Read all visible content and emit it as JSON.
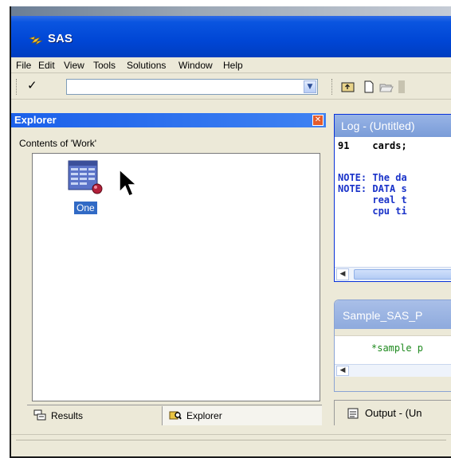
{
  "app": {
    "title": "SAS"
  },
  "menu": [
    "File",
    "Edit",
    "View",
    "Tools",
    "Solutions",
    "Window",
    "Help"
  ],
  "toolbar": {
    "command_value": ""
  },
  "explorer": {
    "title": "Explorer",
    "contents_label": "Contents of 'Work'",
    "items": [
      {
        "label": "One",
        "icon": "dataset-icon",
        "selected": true
      }
    ],
    "tabs": [
      {
        "label": "Results",
        "icon": "results-icon"
      },
      {
        "label": "Explorer",
        "icon": "explorer-icon",
        "active": true
      }
    ]
  },
  "log": {
    "title": "Log - (Untitled)",
    "lines": [
      {
        "text": "91    cards;",
        "type": "code"
      },
      {
        "text": "NOTE: The da",
        "type": "note"
      },
      {
        "text": "NOTE: DATA s",
        "type": "note"
      },
      {
        "text": "      real t",
        "type": "note"
      },
      {
        "text": "      cpu ti",
        "type": "note"
      }
    ]
  },
  "program": {
    "title": "Sample_SAS_P",
    "code": "*sample p"
  },
  "output_tab": {
    "label": "Output - (Un"
  },
  "colors": {
    "titlebar": "#0046d5",
    "explorer_header": "#1b60ea",
    "selection": "#316ac5",
    "note_text": "#1a33c9",
    "comment_text": "#1f8a1f"
  }
}
